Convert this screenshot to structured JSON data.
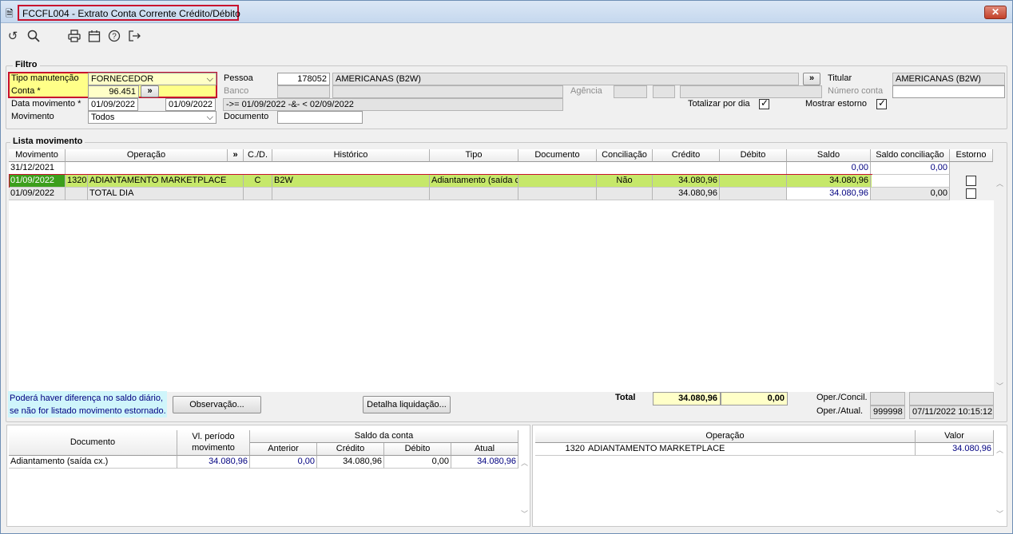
{
  "window": {
    "title": "FCCFL004 - Extrato Conta Corrente Crédito/Débito",
    "close": "✕"
  },
  "toolbar": {
    "icons": [
      "undo-icon",
      "search-icon",
      "print-icon",
      "calendar-icon",
      "help-icon",
      "exit-icon"
    ]
  },
  "filtro": {
    "label": "Filtro",
    "tipo_manutencao": {
      "label": "Tipo manutenção",
      "value": "FORNECEDOR"
    },
    "conta": {
      "label": "Conta *",
      "value": "96.451"
    },
    "data_movimento": {
      "label": "Data movimento *",
      "from": "01/09/2022",
      "to": "01/09/2022",
      "expr": "->= 01/09/2022 -&- < 02/09/2022"
    },
    "movimento": {
      "label": "Movimento",
      "value": "Todos"
    },
    "pessoa": {
      "label": "Pessoa",
      "code": "178052",
      "name": "AMERICANAS (B2W)"
    },
    "banco": {
      "label": "Banco"
    },
    "agencia": {
      "label": "Agência"
    },
    "documento": {
      "label": "Documento",
      "value": ""
    },
    "titular": {
      "label": "Titular",
      "value": "AMERICANAS (B2W)"
    },
    "numero_conta": {
      "label": "Número conta",
      "value": ""
    },
    "totalizar": {
      "label": "Totalizar por dia",
      "checked": true
    },
    "mostrar_estorno": {
      "label": "Mostrar estorno",
      "checked": true
    },
    "expand_glyph": "»"
  },
  "lista": {
    "label": "Lista movimento",
    "columns": [
      "Movimento",
      "Operação",
      "»",
      "C./D.",
      "Histórico",
      "Tipo",
      "Documento",
      "Conciliação",
      "Crédito",
      "Débito",
      "Saldo",
      "Saldo conciliação",
      "Estorno"
    ],
    "rows": [
      {
        "movimento": "31/12/2021",
        "op_code": "",
        "operacao": "",
        "cd": "",
        "historico": "",
        "tipo": "",
        "documento": "",
        "conciliacao": "",
        "credito": "",
        "debito": "",
        "saldo": "0,00",
        "saldo_conc": "0,00",
        "estorno": null
      },
      {
        "movimento": "01/09/2022",
        "op_code": "1320",
        "operacao": "ADIANTAMENTO MARKETPLACE",
        "cd": "C",
        "historico": "B2W",
        "tipo": "Adiantamento (saída c",
        "documento": "",
        "conciliacao": "Não",
        "credito": "34.080,96",
        "debito": "",
        "saldo": "34.080,96",
        "saldo_conc": "",
        "estorno": false
      },
      {
        "movimento": "01/09/2022",
        "op_code": "",
        "operacao": "TOTAL DIA",
        "cd": "",
        "historico": "",
        "tipo": "",
        "documento": "",
        "conciliacao": "",
        "credito": "34.080,96",
        "debito": "",
        "saldo": "34.080,96",
        "saldo_conc": "0,00",
        "estorno": false
      }
    ],
    "selected_row": 1,
    "colors": {
      "selected": "#c6e86a",
      "selected_first": "#3c9f1c"
    }
  },
  "footer": {
    "note_line1": "Poderá haver diferença no saldo diário,",
    "note_line2": "se não for listado movimento estornado.",
    "observacao_button": "Observação...",
    "detalha_button": "Detalha liquidação...",
    "total_label": "Total",
    "total_credito": "34.080,96",
    "total_debito": "0,00",
    "oper_concil_label": "Oper./Concil.",
    "oper_atual_label": "Oper./Atual.",
    "oper_atual_user": "999998",
    "oper_atual_datetime": "07/11/2022 10:15:12"
  },
  "bottom_left": {
    "headers": {
      "documento": "Documento",
      "vl_periodo": "Vl. período movimento",
      "saldo_conta": "Saldo da conta",
      "anterior": "Anterior",
      "credito": "Crédito",
      "debito": "Débito",
      "atual": "Atual"
    },
    "rows": [
      {
        "documento": "Adiantamento (saída cx.)",
        "vl_periodo": "34.080,96",
        "anterior": "0,00",
        "credito": "34.080,96",
        "debito": "0,00",
        "atual": "34.080,96"
      }
    ]
  },
  "bottom_right": {
    "headers": {
      "operacao": "Operação",
      "valor": "Valor"
    },
    "rows": [
      {
        "code": "1320",
        "operacao": "ADIANTAMENTO MARKETPLACE",
        "valor": "34.080,96"
      }
    ]
  }
}
